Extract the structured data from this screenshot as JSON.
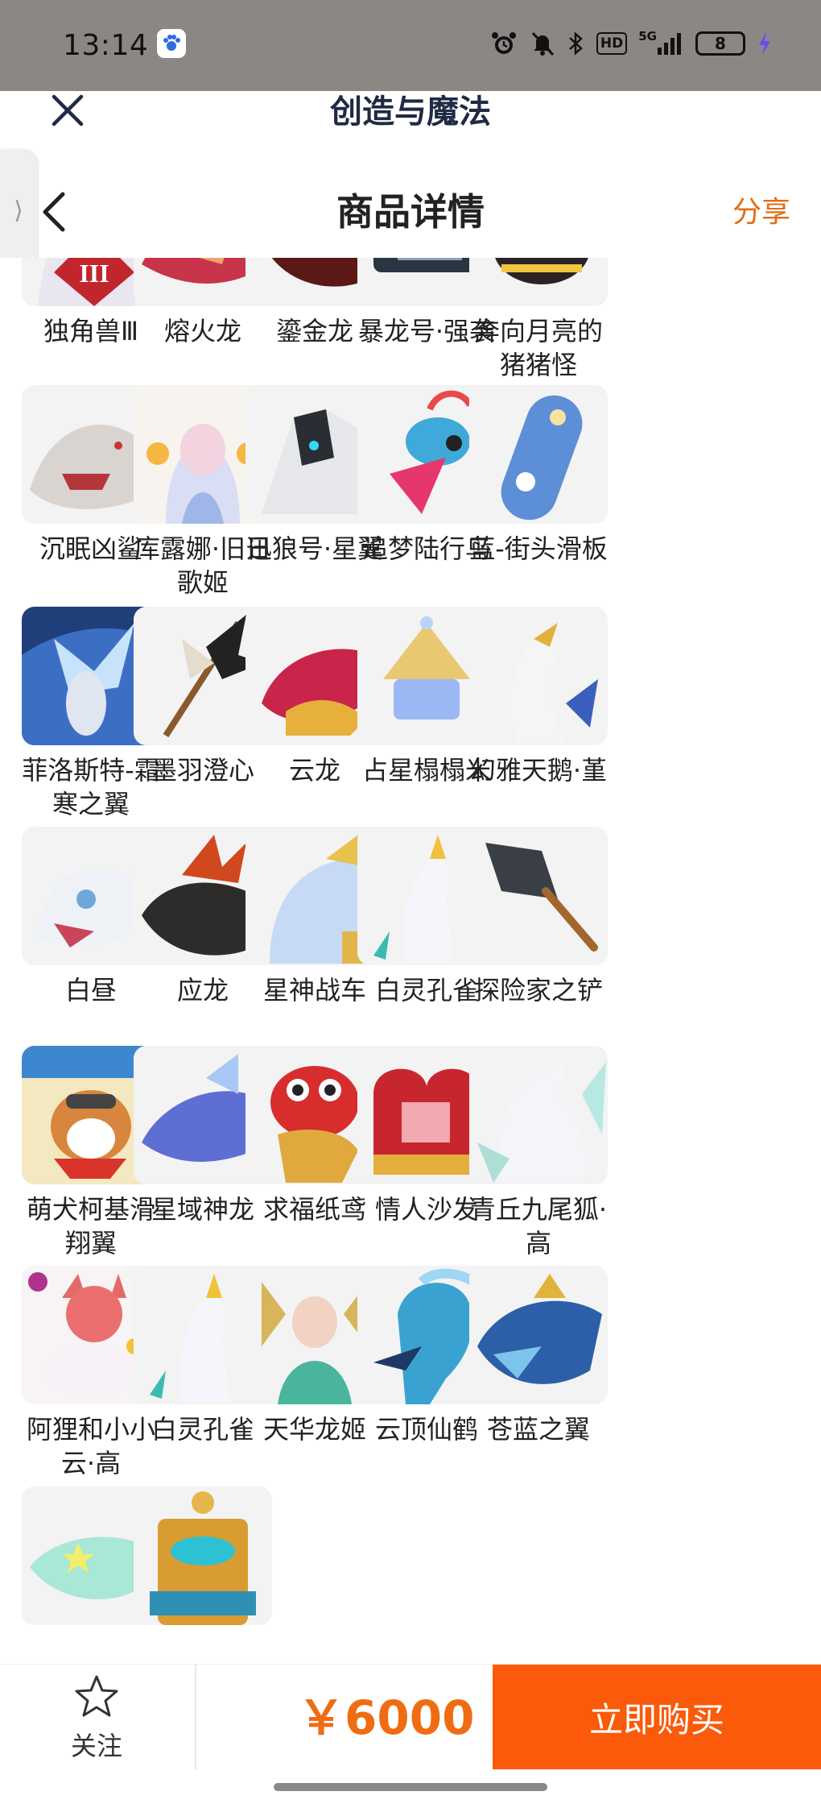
{
  "status_bar": {
    "time": "13:14",
    "network": "5G",
    "hd_badge": "HD",
    "battery": "8",
    "icons": [
      "baidu-app-icon",
      "alarm-icon",
      "mute-icon",
      "bluetooth-icon",
      "signal-icon",
      "battery-icon",
      "charging-icon"
    ]
  },
  "header": {
    "app_title": "创造与魔法",
    "page_title": "商品详情",
    "share_label": "分享"
  },
  "items": [
    {
      "label": "独角兽Ⅲ",
      "badge": "III",
      "icon": "unicorn"
    },
    {
      "label": "熔火龙",
      "icon": "fire-dragon"
    },
    {
      "label": "鎏金龙",
      "icon": "gold-dragon"
    },
    {
      "label": "暴龙号·强袭",
      "icon": "mech"
    },
    {
      "label": "奔向月亮的猪猪怪",
      "icon": "pig"
    },
    {
      "label": "沉眠凶鲨",
      "icon": "shark"
    },
    {
      "label": "库露娜·旧日歌姬",
      "icon": "singer"
    },
    {
      "label": "迅狼号·星翼",
      "icon": "wolf-mech"
    },
    {
      "label": "追梦陆行鸟",
      "icon": "bird"
    },
    {
      "label": "蓝-街头滑板",
      "icon": "skateboard"
    },
    {
      "label": "菲洛斯特-霜寒之翼",
      "icon": "frost-wing"
    },
    {
      "label": "墨羽澄心",
      "icon": "staff"
    },
    {
      "label": "云龙",
      "icon": "cloud-dragon"
    },
    {
      "label": "占星榻榻米",
      "icon": "crystal"
    },
    {
      "label": "幻雅天鹅·堇",
      "icon": "swan"
    },
    {
      "label": "白昼",
      "icon": "white-cat"
    },
    {
      "label": "应龙",
      "icon": "black-dragon"
    },
    {
      "label": "星神战车",
      "icon": "chariot"
    },
    {
      "label": "白灵孔雀",
      "icon": "peacock"
    },
    {
      "label": "探险家之铲",
      "icon": "shovel"
    },
    {
      "label": "萌犬柯基滑翔翼",
      "icon": "corgi"
    },
    {
      "label": "星域神龙",
      "icon": "star-dragon"
    },
    {
      "label": "求福纸鸢",
      "icon": "kite-fish"
    },
    {
      "label": "情人沙发",
      "icon": "sofa"
    },
    {
      "label": "青丘九尾狐·高",
      "icon": "fox"
    },
    {
      "label": "阿狸和小小云·高",
      "icon": "ali"
    },
    {
      "label": "白灵孔雀",
      "icon": "peacock"
    },
    {
      "label": "天华龙姬",
      "icon": "dragon-princess"
    },
    {
      "label": "云顶仙鹤",
      "icon": "crane"
    },
    {
      "label": "苍蓝之翼",
      "icon": "azure-wing"
    },
    {
      "label": "",
      "icon": "light-wing"
    },
    {
      "label": "",
      "icon": "golden-throne"
    }
  ],
  "bottom_bar": {
    "follow_label": "关注",
    "price": "￥6000",
    "buy_label": "立即购买"
  },
  "colors": {
    "accent": "#fa5a0a",
    "price": "#ef6c13",
    "share": "#e06d16",
    "status_bar": "#8b8785"
  }
}
